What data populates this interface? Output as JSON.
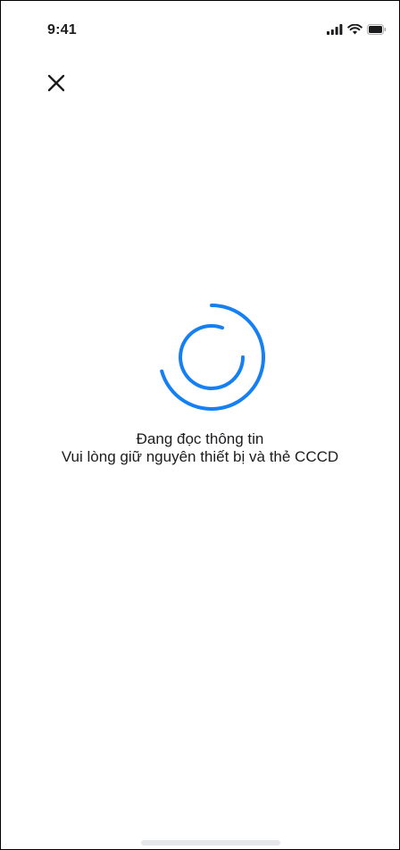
{
  "status_bar": {
    "time": "9:41",
    "icons": [
      "cellular-signal-icon",
      "wifi-icon",
      "battery-icon"
    ]
  },
  "header": {
    "close_icon": "close-icon"
  },
  "loading": {
    "spinner_icon": "loading-spinner-icon",
    "title": "Đang đọc thông tin",
    "subtitle": "Vui lòng giữ nguyên thiết bị và thẻ CCCD"
  },
  "colors": {
    "accent": "#1580f2",
    "text": "#1c1c1e",
    "background": "#ffffff",
    "home_indicator": "#e6e7ea"
  }
}
